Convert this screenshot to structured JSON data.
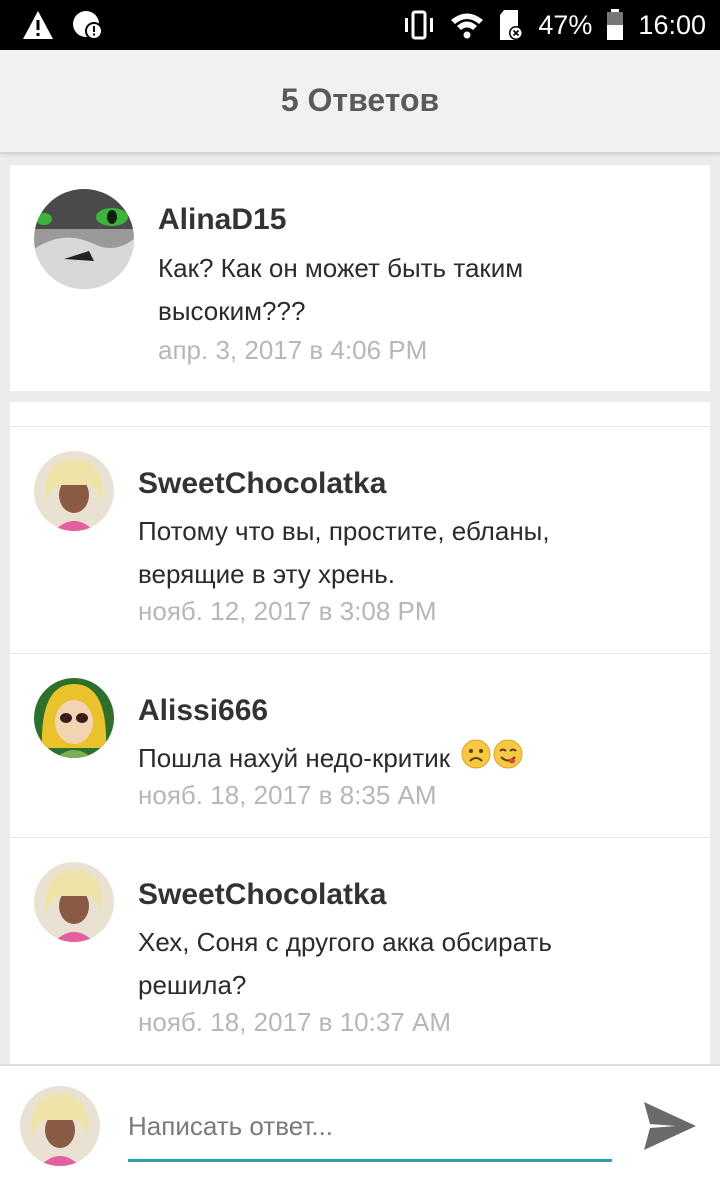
{
  "status_bar": {
    "battery": "47%",
    "time": "16:00",
    "icons_left": [
      "warning-icon",
      "alert-badge-icon"
    ],
    "icons_right": [
      "vibrate-icon",
      "wifi-icon",
      "sd-card-icon",
      "battery-icon"
    ]
  },
  "header": {
    "title": "5 Ответов"
  },
  "main_comment": {
    "username": "AlinaD15",
    "text": "Как?  Как он может быть таким высоким???",
    "date": "апр. 3, 2017 в 4:06 PM"
  },
  "replies": [
    {
      "username": "SweetChocolatka",
      "text": "Потому что вы, простите, ебланы, верящие в эту хрень.",
      "date": "нояб. 12, 2017 в 3:08 PM"
    },
    {
      "username": "Alissi666",
      "text": "Пошла нахуй недо-критик",
      "emoji": [
        "frowning-face-emoji",
        "yum-face-emoji"
      ],
      "date": "нояб. 18, 2017 в 8:35 AM"
    },
    {
      "username": "SweetChocolatka",
      "text": "Хех, Соня с другого акка обсирать решила?",
      "date": "нояб. 18, 2017 в 10:37 AM"
    }
  ],
  "reply_box": {
    "placeholder": "Написать ответ..."
  },
  "colors": {
    "accent": "#2a9fa8",
    "date": "#b7b7b7",
    "title": "#5a5a5a"
  }
}
